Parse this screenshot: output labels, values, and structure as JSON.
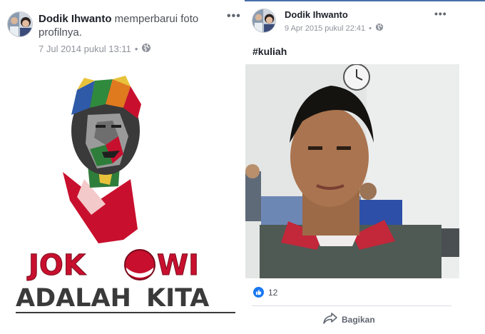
{
  "left_post": {
    "author": "Dodik Ihwanto",
    "action": "memperbarui foto profilnya.",
    "timestamp": "7 Jul 2014 pukul 13:11",
    "separator": "•",
    "audience_icon": "globe-icon",
    "menu_icon": "more-options-icon",
    "more_label": "•••",
    "image": {
      "line1_left": "JOK",
      "line1_right": "WI",
      "line2_left": "ADALAH",
      "line2_right": "KITA"
    }
  },
  "right_post": {
    "author": "Dodik Ihwanto",
    "timestamp": "9 Apr 2015 pukul 22:41",
    "separator": "•",
    "audience_icon": "globe-icon",
    "menu_icon": "more-options-icon",
    "more_label": "•••",
    "caption": "#kuliah",
    "reaction_icon": "like-icon",
    "reaction_count": "12",
    "share_label": "Bagikan",
    "share_icon": "share-arrow-icon"
  },
  "colors": {
    "facebook_blue": "#1877f2",
    "header_bar": "#4a6ea9",
    "logo_red": "#c8102e",
    "logo_dark": "#3a3a3a",
    "meta_gray": "#90949c"
  }
}
